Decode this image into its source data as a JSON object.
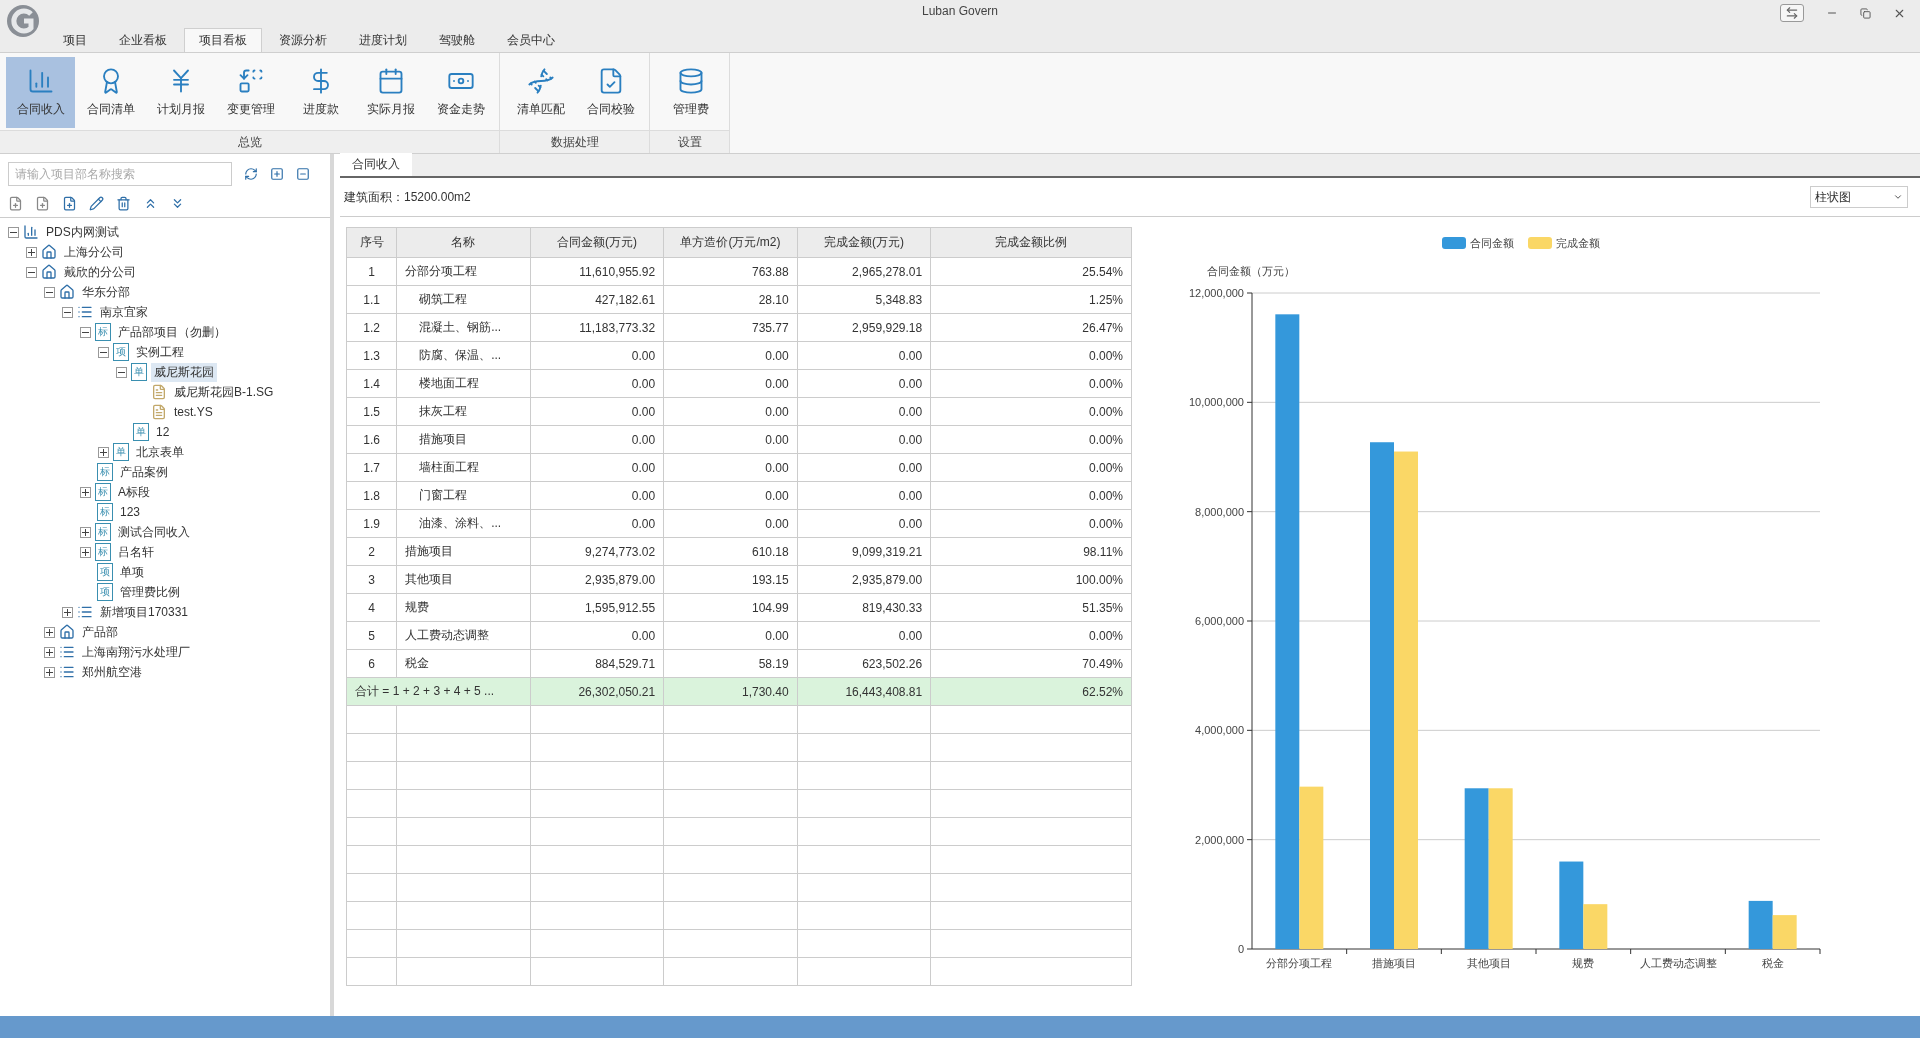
{
  "window": {
    "title": "Luban Govern"
  },
  "menu_tabs": [
    {
      "label": "项目",
      "selected": false
    },
    {
      "label": "企业看板",
      "selected": false
    },
    {
      "label": "项目看板",
      "selected": true
    },
    {
      "label": "资源分析",
      "selected": false
    },
    {
      "label": "进度计划",
      "selected": false
    },
    {
      "label": "驾驶舱",
      "selected": false
    },
    {
      "label": "会员中心",
      "selected": false
    }
  ],
  "ribbon": {
    "groups": [
      {
        "label": "总览",
        "buttons": [
          {
            "label": "合同收入",
            "selected": true
          },
          {
            "label": "合同清单",
            "selected": false
          },
          {
            "label": "计划月报",
            "selected": false
          },
          {
            "label": "变更管理",
            "selected": false
          },
          {
            "label": "进度款",
            "selected": false
          },
          {
            "label": "实际月报",
            "selected": false
          },
          {
            "label": "资金走势",
            "selected": false
          }
        ]
      },
      {
        "label": "数据处理",
        "buttons": [
          {
            "label": "清单匹配",
            "selected": false
          },
          {
            "label": "合同校验",
            "selected": false
          }
        ]
      },
      {
        "label": "设置",
        "buttons": [
          {
            "label": "管理费",
            "selected": false
          }
        ]
      }
    ]
  },
  "sidebar": {
    "search": {
      "placeholder": "请输入项目部名称搜索"
    },
    "tree": [
      {
        "label": "PDS内网测试",
        "kind": "root",
        "expanded": true,
        "selected": false,
        "children": [
          {
            "label": "上海分公司",
            "kind": "company",
            "expanded": false,
            "selected": false
          },
          {
            "label": "戴欣的分公司",
            "kind": "company",
            "expanded": true,
            "selected": false,
            "children": [
              {
                "label": "华东分部",
                "kind": "company",
                "expanded": true,
                "selected": false,
                "children": [
                  {
                    "label": "南京宜家",
                    "kind": "list",
                    "expanded": true,
                    "selected": false,
                    "children": [
                      {
                        "label": "产品部项目（勿删）",
                        "kind": "glyph",
                        "glyph": "标",
                        "expanded": true,
                        "selected": false,
                        "children": [
                          {
                            "label": "实例工程",
                            "kind": "glyph",
                            "glyph": "项",
                            "expanded": true,
                            "selected": false,
                            "children": [
                              {
                                "label": "威尼斯花园",
                                "kind": "glyph",
                                "glyph": "单",
                                "expanded": true,
                                "selected": true,
                                "children": [
                                  {
                                    "label": "威尼斯花园B-1.SG",
                                    "kind": "file",
                                    "selected": false
                                  },
                                  {
                                    "label": "test.YS",
                                    "kind": "file",
                                    "selected": false
                                  }
                                ]
                              },
                              {
                                "label": "12",
                                "kind": "glyph",
                                "glyph": "单",
                                "selected": false
                              }
                            ]
                          },
                          {
                            "label": "北京表单",
                            "kind": "glyph",
                            "glyph": "单",
                            "expanded": false,
                            "selected": false
                          }
                        ]
                      },
                      {
                        "label": "产品案例",
                        "kind": "glyph",
                        "glyph": "标",
                        "selected": false
                      },
                      {
                        "label": "A标段",
                        "kind": "glyph",
                        "glyph": "标",
                        "expanded": false,
                        "selected": false
                      },
                      {
                        "label": "123",
                        "kind": "glyph",
                        "glyph": "标",
                        "selected": false
                      },
                      {
                        "label": "测试合同收入",
                        "kind": "glyph",
                        "glyph": "标",
                        "expanded": false,
                        "selected": false
                      },
                      {
                        "label": "吕名轩",
                        "kind": "glyph",
                        "glyph": "标",
                        "expanded": false,
                        "selected": false
                      },
                      {
                        "label": "单项",
                        "kind": "glyph",
                        "glyph": "项",
                        "selected": false
                      },
                      {
                        "label": "管理费比例",
                        "kind": "glyph",
                        "glyph": "项",
                        "selected": false
                      }
                    ]
                  },
                  {
                    "label": "新增项目170331",
                    "kind": "list",
                    "expanded": false,
                    "selected": false
                  }
                ]
              },
              {
                "label": "产品部",
                "kind": "company",
                "expanded": false,
                "selected": false
              },
              {
                "label": "上海南翔污水处理厂",
                "kind": "list",
                "expanded": false,
                "selected": false
              },
              {
                "label": "郑州航空港",
                "kind": "list",
                "expanded": false,
                "selected": false
              }
            ]
          }
        ]
      }
    ]
  },
  "doc_tabs": [
    {
      "label": "合同收入",
      "selected": true
    }
  ],
  "building_area": "建筑面积：15200.00m2",
  "chart_type_select": {
    "value": "柱状图"
  },
  "table": {
    "columns": [
      "序号",
      "名称",
      "合同金额(万元)",
      "单方造价(万元/m2)",
      "完成金额(万元)",
      "完成金额比例"
    ],
    "rows": [
      {
        "kind": "item",
        "cells": [
          "1",
          "分部分项工程",
          "11,610,955.92",
          "763.88",
          "2,965,278.01",
          "25.54%"
        ]
      },
      {
        "kind": "sub",
        "cells": [
          "1.1",
          "砌筑工程",
          "427,182.61",
          "28.10",
          "5,348.83",
          "1.25%"
        ]
      },
      {
        "kind": "sub",
        "cells": [
          "1.2",
          "混凝土、钢筋...",
          "11,183,773.32",
          "735.77",
          "2,959,929.18",
          "26.47%"
        ]
      },
      {
        "kind": "sub",
        "cells": [
          "1.3",
          "防腐、保温、...",
          "0.00",
          "0.00",
          "0.00",
          "0.00%"
        ]
      },
      {
        "kind": "sub",
        "cells": [
          "1.4",
          "楼地面工程",
          "0.00",
          "0.00",
          "0.00",
          "0.00%"
        ]
      },
      {
        "kind": "sub",
        "cells": [
          "1.5",
          "抹灰工程",
          "0.00",
          "0.00",
          "0.00",
          "0.00%"
        ]
      },
      {
        "kind": "sub",
        "cells": [
          "1.6",
          "措施项目",
          "0.00",
          "0.00",
          "0.00",
          "0.00%"
        ]
      },
      {
        "kind": "sub",
        "cells": [
          "1.7",
          "墙柱面工程",
          "0.00",
          "0.00",
          "0.00",
          "0.00%"
        ]
      },
      {
        "kind": "sub",
        "cells": [
          "1.8",
          "门窗工程",
          "0.00",
          "0.00",
          "0.00",
          "0.00%"
        ]
      },
      {
        "kind": "sub",
        "cells": [
          "1.9",
          "油漆、涂料、...",
          "0.00",
          "0.00",
          "0.00",
          "0.00%"
        ]
      },
      {
        "kind": "item",
        "cells": [
          "2",
          "措施项目",
          "9,274,773.02",
          "610.18",
          "9,099,319.21",
          "98.11%"
        ]
      },
      {
        "kind": "item",
        "cells": [
          "3",
          "其他项目",
          "2,935,879.00",
          "193.15",
          "2,935,879.00",
          "100.00%"
        ]
      },
      {
        "kind": "item",
        "cells": [
          "4",
          "规费",
          "1,595,912.55",
          "104.99",
          "819,430.33",
          "51.35%"
        ]
      },
      {
        "kind": "item",
        "cells": [
          "5",
          "人工费动态调整",
          "0.00",
          "0.00",
          "0.00",
          "0.00%"
        ]
      },
      {
        "kind": "item",
        "cells": [
          "6",
          "税金",
          "884,529.71",
          "58.19",
          "623,502.26",
          "70.49%"
        ]
      },
      {
        "kind": "total",
        "cells": [
          {
            "text": "合计 = 1 + 2 + 3 + 4 + 5 ...",
            "colspan": 2
          },
          "26,302,050.21",
          "1,730.40",
          "16,443,408.81",
          "62.52%"
        ]
      }
    ]
  },
  "chart": {
    "chart_data": {
      "type": "bar",
      "ylabel": "合同金额（万元）",
      "categories": [
        "分部分项工程",
        "措施项目",
        "其他项目",
        "规费",
        "人工费动态调整",
        "税金"
      ],
      "series": [
        {
          "name": "合同金额",
          "color": "#3498db",
          "values": [
            11610000,
            9270000,
            2940000,
            1600000,
            0,
            880000
          ]
        },
        {
          "name": "完成金额",
          "color": "#fad766",
          "values": [
            2970000,
            9100000,
            2940000,
            820000,
            0,
            620000
          ]
        }
      ],
      "legend": true,
      "grid": true,
      "ylim": [
        0,
        12000000
      ],
      "yticks": [
        {
          "value": 0,
          "label": "0"
        },
        {
          "value": 2000000,
          "label": "2,000,000"
        },
        {
          "value": 4000000,
          "label": "4,000,000"
        },
        {
          "value": 6000000,
          "label": "6,000,000"
        },
        {
          "value": 8000000,
          "label": "8,000,000"
        },
        {
          "value": 10000000,
          "label": "10,000,000"
        },
        {
          "value": 12000000,
          "label": "12,000,000"
        }
      ]
    }
  }
}
